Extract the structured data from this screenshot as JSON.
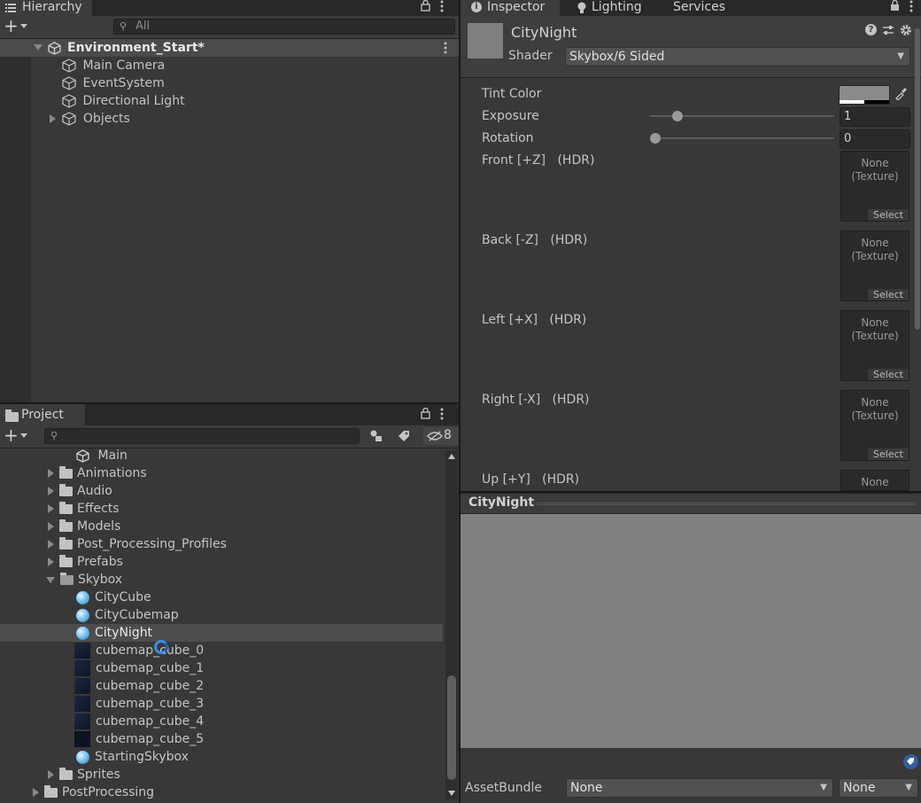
{
  "hierarchy": {
    "tab_label": "Hierarchy",
    "search_placeholder": "All",
    "scene_name": "Environment_Start*",
    "items": [
      {
        "label": "Main Camera"
      },
      {
        "label": "EventSystem"
      },
      {
        "label": "Directional Light"
      },
      {
        "label": "Objects"
      }
    ]
  },
  "project": {
    "tab_label": "Project",
    "hidden_count": "8",
    "tree": [
      {
        "label": "Main"
      },
      {
        "label": "Animations"
      },
      {
        "label": "Audio"
      },
      {
        "label": "Effects"
      },
      {
        "label": "Models"
      },
      {
        "label": "Post_Processing_Profiles"
      },
      {
        "label": "Prefabs"
      },
      {
        "label": "Skybox"
      },
      {
        "label": "CityCube"
      },
      {
        "label": "CityCubemap"
      },
      {
        "label": "CityNight"
      },
      {
        "label": "cubemap_cube_0"
      },
      {
        "label": "cubemap_cube_1"
      },
      {
        "label": "cubemap_cube_2"
      },
      {
        "label": "cubemap_cube_3"
      },
      {
        "label": "cubemap_cube_4"
      },
      {
        "label": "cubemap_cube_5"
      },
      {
        "label": "StartingSkybox"
      },
      {
        "label": "Sprites"
      },
      {
        "label": "PostProcessing"
      }
    ]
  },
  "inspector": {
    "tabs": [
      {
        "label": "Inspector"
      },
      {
        "label": "Lighting"
      },
      {
        "label": "Services"
      }
    ],
    "material_name": "CityNight",
    "shader_label": "Shader",
    "shader_value": "Skybox/6 Sided",
    "tint_label": "Tint Color",
    "exposure_label": "Exposure",
    "exposure_value": "1",
    "exposure_level": 0.13,
    "rotation_label": "Rotation",
    "rotation_value": "0",
    "rotation_level": 0.0,
    "textures": [
      {
        "label": "Front [+Z]",
        "hdr": "(HDR)"
      },
      {
        "label": "Back [-Z]",
        "hdr": "(HDR)"
      },
      {
        "label": "Left [+X]",
        "hdr": "(HDR)"
      },
      {
        "label": "Right [-X]",
        "hdr": "(HDR)"
      },
      {
        "label": "Up [+Y]",
        "hdr": "(HDR)"
      }
    ],
    "tex_none": "None\n(Texture)",
    "tex_select": "Select",
    "preview_title": "CityNight",
    "assetbundle_label": "AssetBundle",
    "assetbundle_value": "None",
    "assetbundle_variant": "None"
  },
  "colors": {
    "panel_bg": "#383838",
    "tab_bar": "#282828",
    "selected_row": "#4d4d4d",
    "preview_bg": "#808080",
    "accent_blue": "#3a8ee6"
  }
}
